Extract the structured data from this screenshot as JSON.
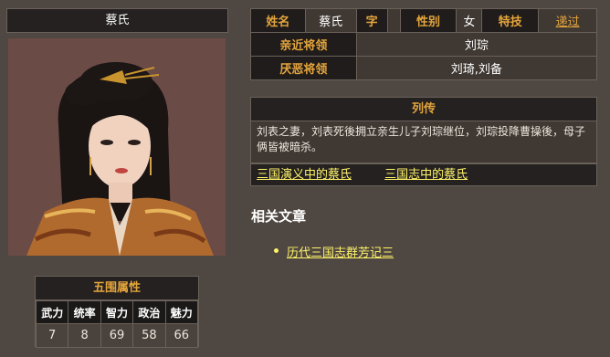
{
  "character": {
    "name": "蔡氏"
  },
  "profile": {
    "surname_label": "姓名",
    "surname_value": "蔡氏",
    "courtesy_label": "字",
    "courtesy_value": "",
    "gender_label": "性别",
    "gender_value": "女",
    "skill_label": "特技",
    "skill_value": "递过",
    "close_generals_label": "亲近将领",
    "close_generals_value": "刘琮",
    "disliked_generals_label": "厌恶将领",
    "disliked_generals_value": "刘琦,刘备"
  },
  "biography": {
    "title": "列传",
    "text": "刘表之妻，刘表死後拥立亲生儿子刘琮继位，刘琮投降曹操後，母子俩皆被暗杀。",
    "links": [
      "三国演义中的蔡氏",
      "三国志中的蔡氏"
    ]
  },
  "related": {
    "title": "相关文章",
    "items": [
      "历代三国志群芳记三"
    ]
  },
  "stats": {
    "title": "五围属性",
    "headers": [
      "武力",
      "统率",
      "智力",
      "政治",
      "魅力"
    ],
    "values": [
      "7",
      "8",
      "69",
      "58",
      "66"
    ]
  }
}
